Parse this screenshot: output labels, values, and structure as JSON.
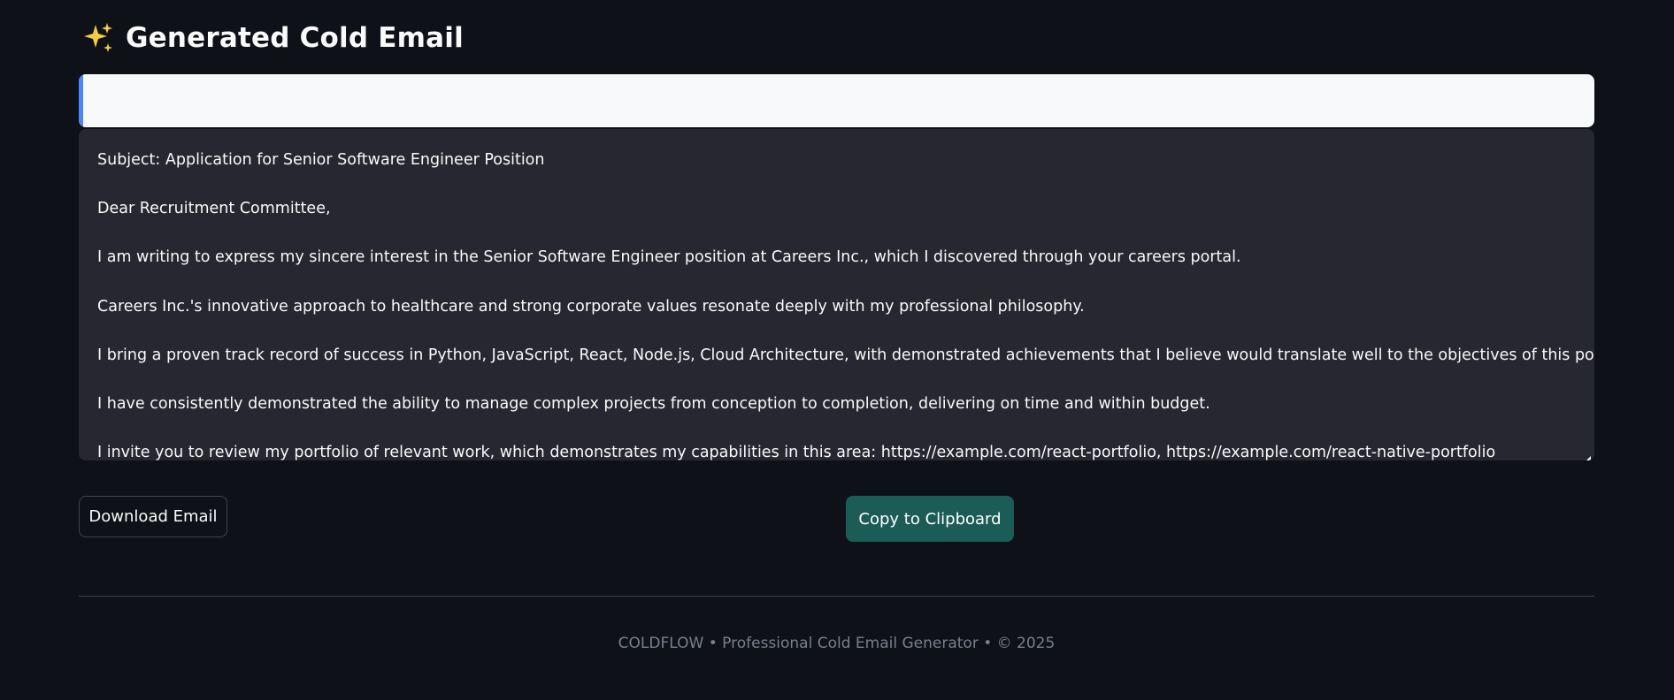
{
  "header": {
    "icon": "sparkles-icon",
    "title": "Generated Cold Email"
  },
  "colors": {
    "background": "#0e1117",
    "info_bar": "#f8f9fb",
    "info_accent": "#4a86f7",
    "email_area": "#262730",
    "copy_button": "#1b5c56",
    "footer_text": "#7a7f8c"
  },
  "email": {
    "subject_line": "Subject: Application for Senior Software Engineer Position",
    "greeting": "Dear Recruitment Committee,",
    "paragraph_1": "I am writing to express my sincere interest in the Senior Software Engineer position at Careers Inc., which I discovered through your careers portal.",
    "paragraph_2": "Careers Inc.'s innovative approach to healthcare and strong corporate values resonate deeply with my professional philosophy.",
    "paragraph_3": "I bring a proven track record of success in Python, JavaScript, React, Node.js, Cloud Architecture, with demonstrated achievements that I believe would translate well to the objectives of this position.",
    "paragraph_4": "I have consistently demonstrated the ability to manage complex projects from conception to completion, delivering on time and within budget.",
    "paragraph_5": "I invite you to review my portfolio of relevant work, which demonstrates my capabilities in this area: https://example.com/react-portfolio, https://example.com/react-native-portfolio"
  },
  "actions": {
    "download_label": "Download Email",
    "copy_label": "Copy to Clipboard"
  },
  "footer": {
    "text": "COLDFLOW • Professional Cold Email Generator • © 2025"
  }
}
